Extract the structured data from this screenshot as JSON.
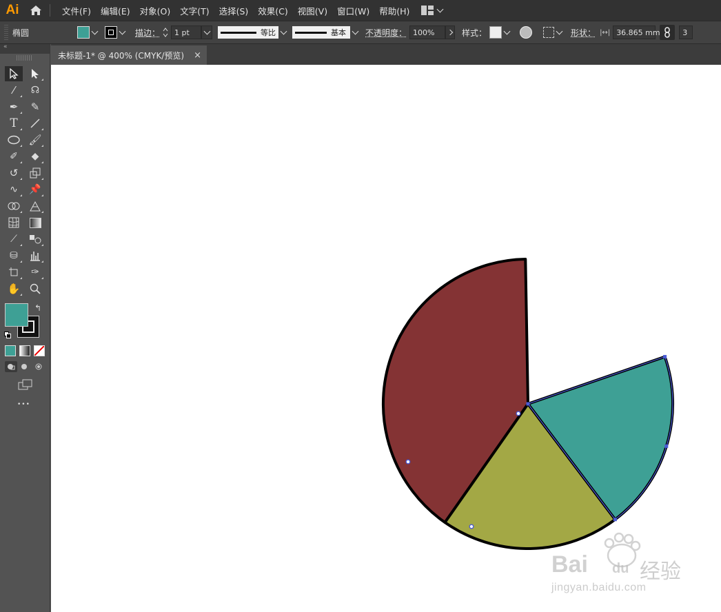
{
  "app": {
    "logo": "Ai"
  },
  "menu": [
    "文件(F)",
    "编辑(E)",
    "对象(O)",
    "文字(T)",
    "选择(S)",
    "效果(C)",
    "视图(V)",
    "窗口(W)",
    "帮助(H)"
  ],
  "control_bar": {
    "object_type": "椭圆",
    "fill_color": "#3ea095",
    "stroke_label": "描边：",
    "stroke_weight": "1 pt",
    "stroke_profile": "等比",
    "brush": "基本",
    "opacity_label": "不透明度：",
    "opacity": "100%",
    "style_label": "样式：",
    "shape_label": "形状：",
    "width": "36.865 mm",
    "overflow_char": "3"
  },
  "document_tab": {
    "title": "未标题-1* @ 400% (CMYK/预览)",
    "close": "×"
  },
  "toolbar": {
    "collapse": "«",
    "more": "•••"
  },
  "colors": {
    "fill": "#3ea095",
    "stroke": "#000000",
    "slice_red": "#843334",
    "slice_olive": "#a3a845",
    "slice_teal": "#3ea095",
    "selection": "#4a5bd4"
  },
  "chart_data": {
    "type": "pie",
    "values": [
      40,
      20,
      20
    ]
  },
  "watermark": {
    "brand": "Bai",
    "brand_cn": "经验",
    "url": "jingyan.baidu.com"
  }
}
